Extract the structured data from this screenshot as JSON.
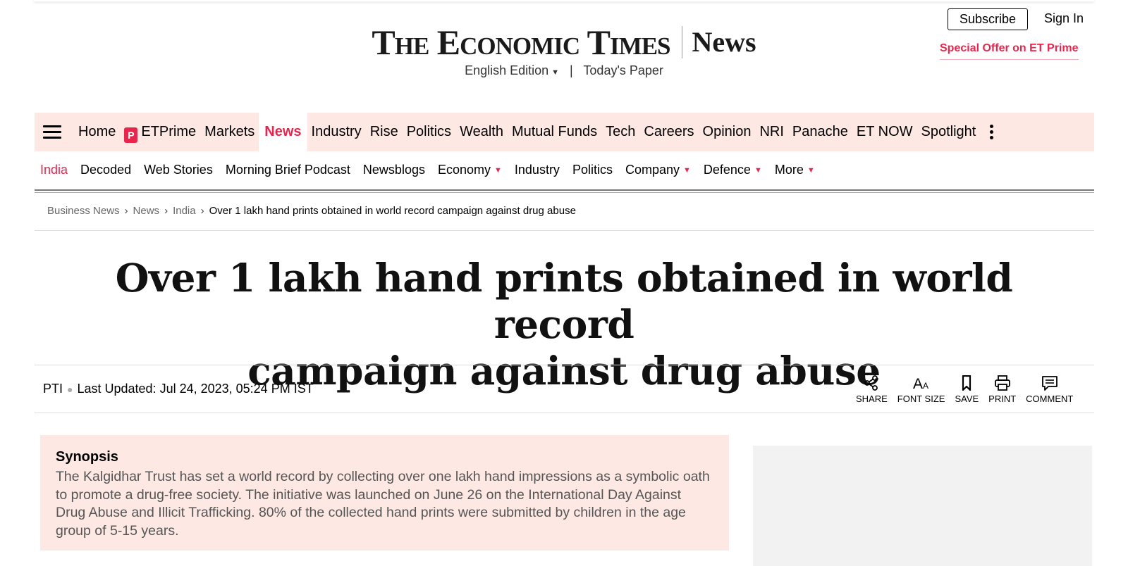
{
  "header": {
    "logo_text": "The Economic Times",
    "section_title": "News",
    "edition_label": "English Edition",
    "todays_paper": "Today's Paper",
    "subscribe_label": "Subscribe",
    "signin_label": "Sign In",
    "offer_label": "Special Offer on ET Prime"
  },
  "main_nav": {
    "items": [
      "Home",
      "ETPrime",
      "Markets",
      "News",
      "Industry",
      "Rise",
      "Politics",
      "Wealth",
      "Mutual Funds",
      "Tech",
      "Careers",
      "Opinion",
      "NRI",
      "Panache",
      "ET NOW",
      "Spotlight"
    ],
    "active": "News",
    "etprime_badge": "P"
  },
  "sub_nav": {
    "items": [
      "India",
      "Decoded",
      "Web Stories",
      "Morning Brief Podcast",
      "Newsblogs",
      "Economy",
      "Industry",
      "Politics",
      "Company",
      "Defence",
      "More"
    ],
    "active": "India",
    "dropdown_items": [
      "Economy",
      "Company",
      "Defence",
      "More"
    ]
  },
  "breadcrumb": {
    "items": [
      "Business News",
      "News",
      "India"
    ],
    "current": "Over 1 lakh hand prints obtained in world record campaign against drug abuse"
  },
  "article": {
    "headline_line1": "Over 1 lakh hand prints obtained in world record",
    "headline_line2": "campaign against drug abuse",
    "source": "PTI",
    "updated": "Last Updated: Jul 24, 2023, 05:24 PM IST"
  },
  "tools": {
    "share": "SHARE",
    "font_size": "FONT SIZE",
    "save": "SAVE",
    "print": "PRINT",
    "comment": "COMMENT"
  },
  "synopsis": {
    "title": "Synopsis",
    "text": "The Kalgidhar Trust has set a world record by collecting over one lakh hand impressions as a symbolic oath to promote a drug-free society. The initiative was launched on June 26 on the International Day Against Drug Abuse and Illicit Trafficking. 80% of the collected hand prints were submitted by children in the age group of 5-15 years."
  },
  "colors": {
    "accent": "#e7254d",
    "nav_bg": "#fde8e3",
    "ad_bg": "#f2f2f2"
  }
}
